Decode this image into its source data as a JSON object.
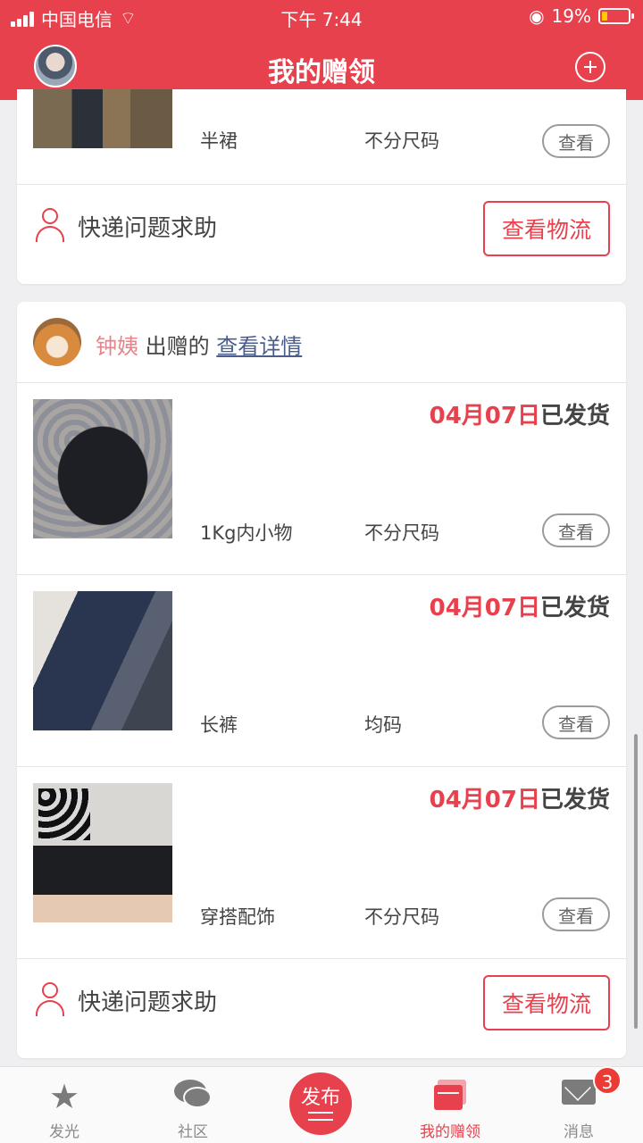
{
  "status_bar": {
    "carrier": "中国电信",
    "time": "下午 7:44",
    "battery": "19%"
  },
  "header": {
    "title": "我的赠领"
  },
  "card1": {
    "item": {
      "category": "半裙",
      "size": "不分尺码",
      "view_label": "查看"
    },
    "help_label": "快递问题求助",
    "logistics_label": "查看物流"
  },
  "card2": {
    "giver": {
      "name": "钟姨",
      "action": "出赠的",
      "detail_link": "查看详情"
    },
    "items": [
      {
        "date": "04月07日",
        "status": "已发货",
        "category": "1Kg内小物",
        "size": "不分尺码",
        "view_label": "查看"
      },
      {
        "date": "04月07日",
        "status": "已发货",
        "category": "长裤",
        "size": "均码",
        "view_label": "查看"
      },
      {
        "date": "04月07日",
        "status": "已发货",
        "category": "穿搭配饰",
        "size": "不分尺码",
        "view_label": "查看"
      }
    ],
    "help_label": "快递问题求助",
    "logistics_label": "查看物流"
  },
  "tabbar": {
    "tabs": [
      {
        "label": "发光",
        "icon": "star-icon"
      },
      {
        "label": "社区",
        "icon": "chat-icon"
      },
      {
        "label": "发布",
        "icon": "publish-icon"
      },
      {
        "label": "我的赠领",
        "icon": "gift-icon",
        "active": true
      },
      {
        "label": "消息",
        "icon": "mail-icon"
      }
    ],
    "badge": "3"
  },
  "colors": {
    "accent": "#e8414e",
    "text": "#444444",
    "background": "#efeff1"
  }
}
